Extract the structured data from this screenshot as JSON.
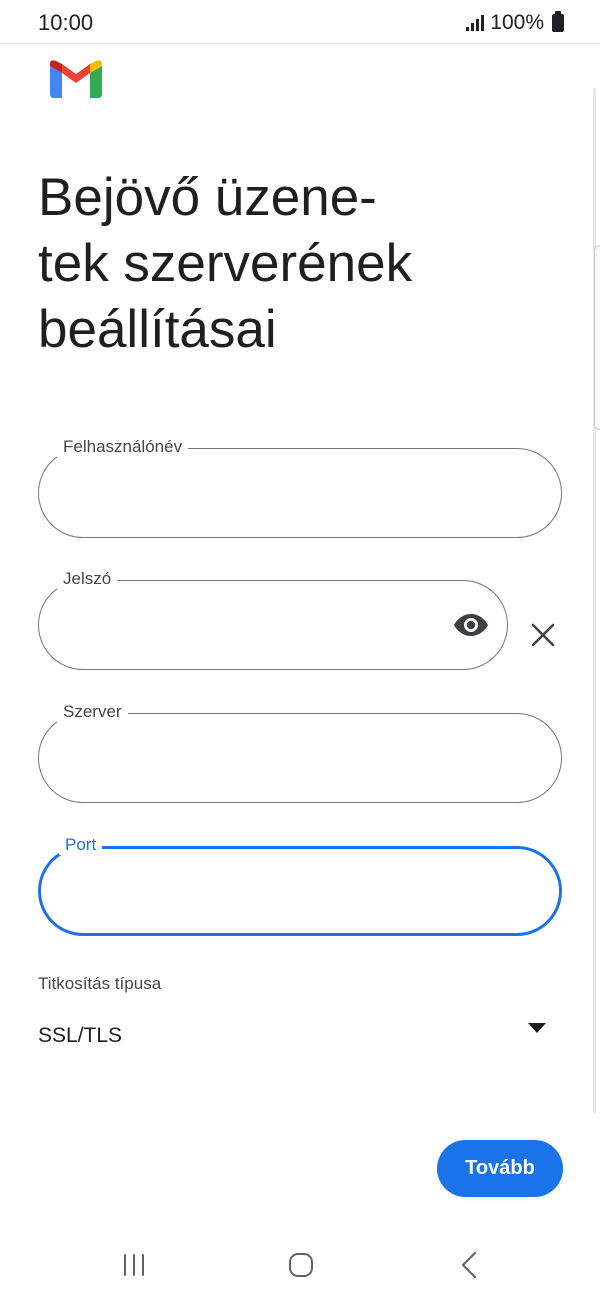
{
  "status_bar": {
    "time": "10:00",
    "battery": "100%",
    "icons": [
      "signal-icon",
      "battery-icon"
    ]
  },
  "app": {
    "logo": "gmail-logo",
    "brand_colors": {
      "blue": "#4285F4",
      "red": "#EA4335",
      "yellow": "#FBBC04",
      "green": "#34A853"
    }
  },
  "title": "Bejövő üzene-\ntek szerverének\nbeállításai",
  "form": {
    "username": {
      "label": "Felhasználónév",
      "value": ""
    },
    "password": {
      "label": "Jelszó",
      "value": "",
      "icons": [
        "eye-icon",
        "close-icon"
      ]
    },
    "server": {
      "label": "Szerver",
      "value": ""
    },
    "port": {
      "label": "Port",
      "value": "",
      "focused": true
    },
    "encryption": {
      "label": "Titkosítás típusa",
      "value": "SSL/TLS",
      "icon": "dropdown-arrow-icon"
    }
  },
  "next_button": {
    "label": "Tovább",
    "color": "#1A73E8"
  },
  "nav_bar": {
    "icons": [
      "recents-icon",
      "home-icon",
      "back-icon"
    ]
  },
  "colors": {
    "accent": "#1A73E8",
    "outline": "#747775",
    "text": "#1F1F1F"
  }
}
